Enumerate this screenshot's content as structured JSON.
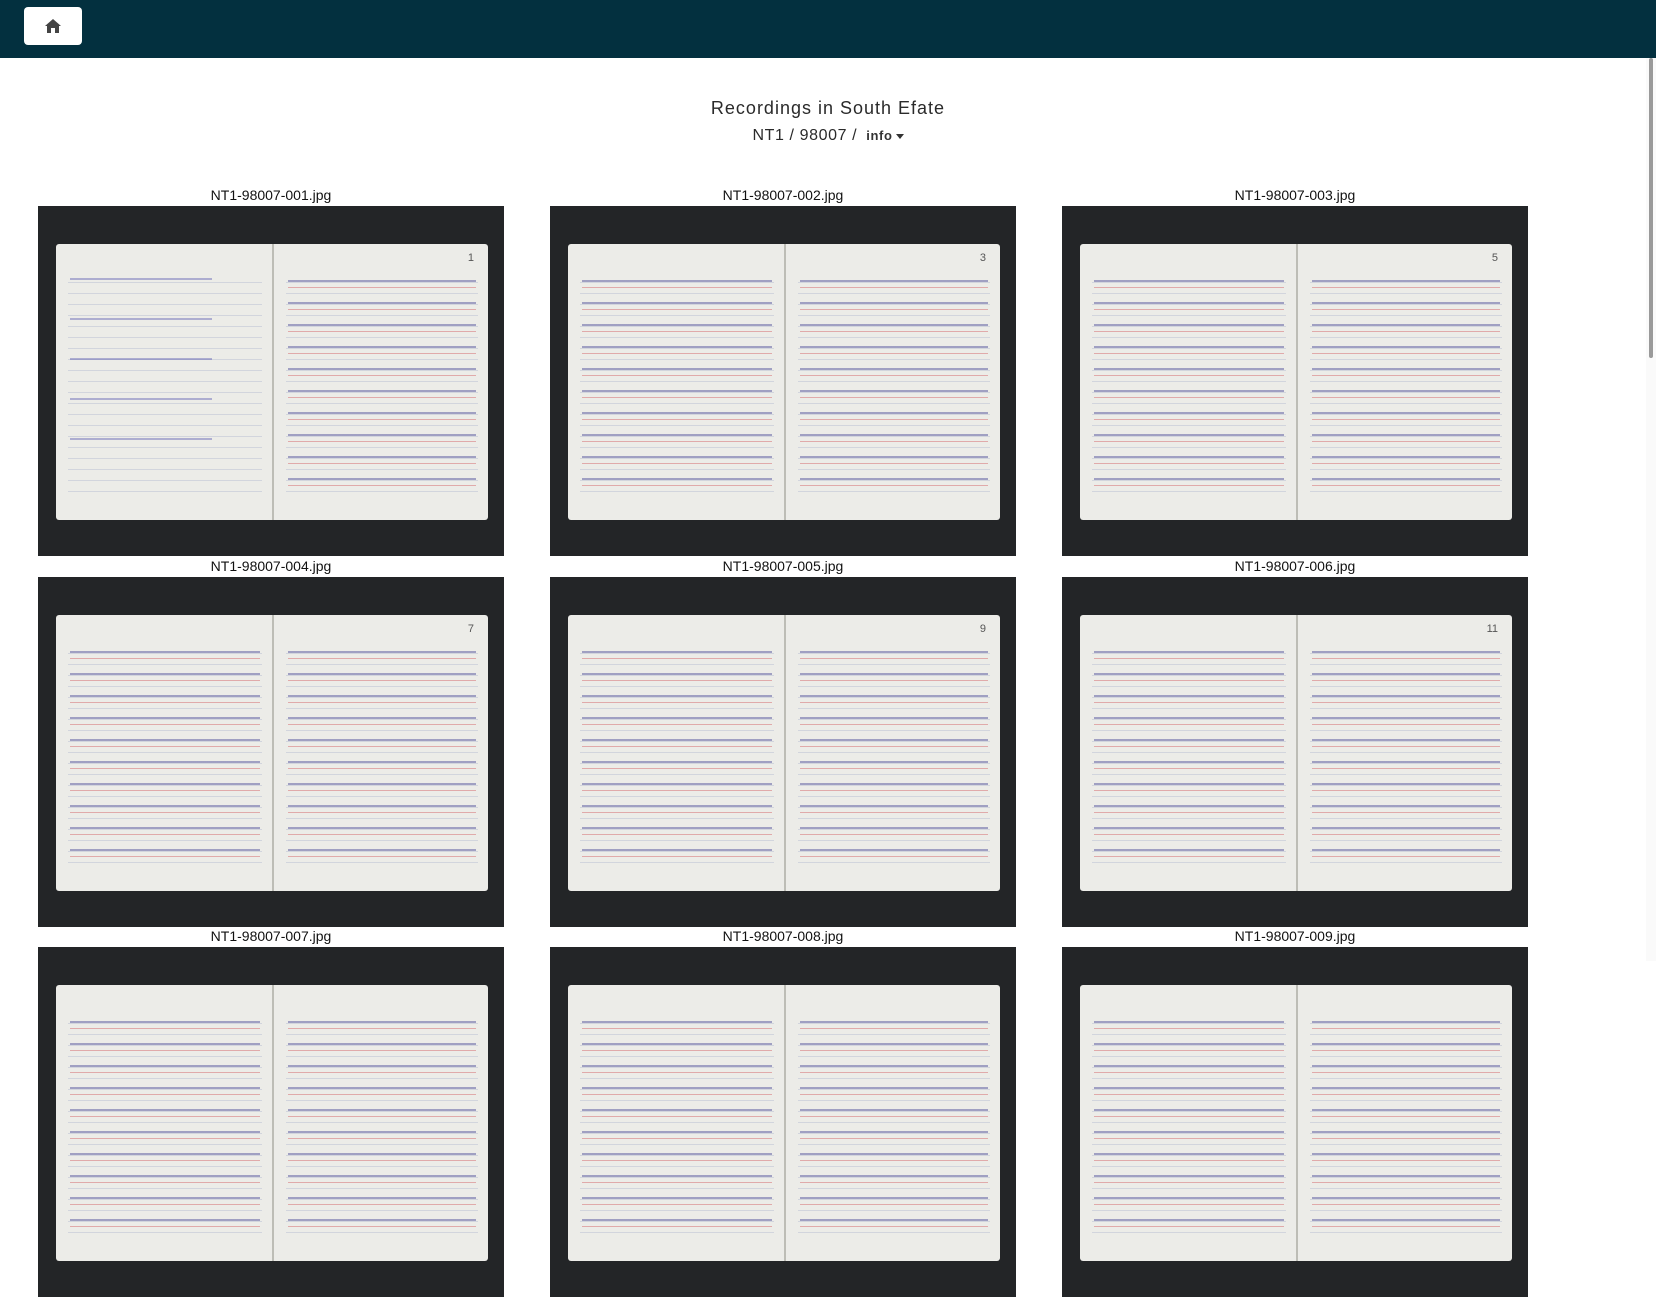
{
  "header": {
    "home_icon": "home-icon"
  },
  "title": "Recordings in South Efate",
  "breadcrumb": {
    "collection": "NT1",
    "sep1": " / ",
    "item": "98007",
    "sep2": " / ",
    "info_label": "info"
  },
  "images": [
    {
      "file": "NT1-98007-001.jpg",
      "page_num": "1"
    },
    {
      "file": "NT1-98007-002.jpg",
      "page_num": "3"
    },
    {
      "file": "NT1-98007-003.jpg",
      "page_num": "5"
    },
    {
      "file": "NT1-98007-004.jpg",
      "page_num": "7"
    },
    {
      "file": "NT1-98007-005.jpg",
      "page_num": "9"
    },
    {
      "file": "NT1-98007-006.jpg",
      "page_num": "11"
    },
    {
      "file": "NT1-98007-007.jpg",
      "page_num": ""
    },
    {
      "file": "NT1-98007-008.jpg",
      "page_num": ""
    },
    {
      "file": "NT1-98007-009.jpg",
      "page_num": ""
    }
  ]
}
